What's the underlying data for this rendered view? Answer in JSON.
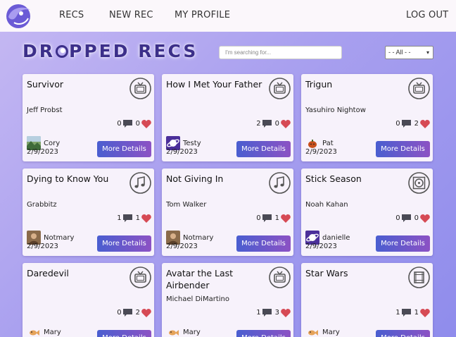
{
  "nav": {
    "recs": "RECS",
    "new_rec": "NEW REC",
    "my_profile": "MY PROFILE",
    "logout": "LOG OUT"
  },
  "brand": {
    "before": "DR",
    "after": "PPED RECS"
  },
  "search": {
    "placeholder": "I'm searching for..."
  },
  "filter": {
    "selected": "- - All - -"
  },
  "colors": {
    "accent": "#4a5ed0",
    "accent2": "#8c52c4",
    "heart": "#d64a55",
    "brand": "#3c2f8a"
  },
  "button_label": "More Details",
  "cards": [
    {
      "title": "Survivor",
      "creator": "Jeff Probst",
      "comments": "0",
      "likes": "0",
      "user": "Cory",
      "date": "2/9/2023",
      "type_icon": "tv-icon",
      "avatar": "landscape"
    },
    {
      "title": "How I Met Your Father",
      "creator": "",
      "comments": "2",
      "likes": "0",
      "user": "Testy",
      "date": "2/9/2023",
      "type_icon": "tv-icon",
      "avatar": "planet"
    },
    {
      "title": "Trigun",
      "creator": "Yasuhiro Nightow",
      "comments": "0",
      "likes": "2",
      "user": "Pat",
      "date": "2/9/2023",
      "type_icon": "tv-icon",
      "avatar": "pumpkin"
    },
    {
      "title": "Dying to Know You",
      "creator": "Grabbitz",
      "comments": "1",
      "likes": "1",
      "user": "Notmary",
      "date": "2/9/2023",
      "type_icon": "music-icon",
      "avatar": "photo"
    },
    {
      "title": "Not Giving In",
      "creator": "Tom Walker",
      "comments": "0",
      "likes": "1",
      "user": "Notmary",
      "date": "2/9/2023",
      "type_icon": "music-icon",
      "avatar": "photo"
    },
    {
      "title": "Stick Season",
      "creator": "Noah Kahan",
      "comments": "0",
      "likes": "0",
      "user": "danielle",
      "date": "2/9/2023",
      "type_icon": "vinyl-icon",
      "avatar": "planet"
    },
    {
      "title": "Daredevil",
      "creator": "",
      "comments": "0",
      "likes": "2",
      "user": "Mary",
      "date": "",
      "type_icon": "tv-icon",
      "avatar": "fish"
    },
    {
      "title": "Avatar the Last Airbender",
      "creator": "Michael DiMartino",
      "comments": "1",
      "likes": "3",
      "user": "Mary",
      "date": "",
      "type_icon": "tv-icon",
      "avatar": "fish"
    },
    {
      "title": "Star Wars",
      "creator": "",
      "comments": "1",
      "likes": "1",
      "user": "Mary",
      "date": "",
      "type_icon": "film-icon",
      "avatar": "fish"
    }
  ]
}
